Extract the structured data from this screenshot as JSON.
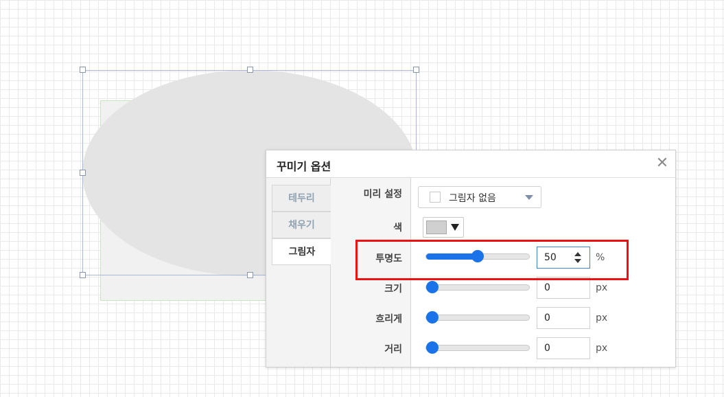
{
  "dialog": {
    "title": "꾸미기 옵션",
    "close_glyph": "✕"
  },
  "tabs": [
    {
      "label": "테두리",
      "active": false
    },
    {
      "label": "채우기",
      "active": false
    },
    {
      "label": "그림자",
      "active": true
    }
  ],
  "fields": {
    "preset": {
      "label": "미리 설정",
      "value": "그림자 없음"
    },
    "color": {
      "label": "색",
      "value": "#d0d0d0"
    },
    "opacity": {
      "label": "투명도",
      "value": "50",
      "unit": "%",
      "level": 0.5
    },
    "size": {
      "label": "크기",
      "value": "0",
      "unit": "px",
      "level": 0
    },
    "blur": {
      "label": "흐리게",
      "value": "0",
      "unit": "px",
      "level": 0
    },
    "distance": {
      "label": "거리",
      "value": "0",
      "unit": "px",
      "level": 0
    }
  },
  "colors": {
    "accent": "#1a73e8",
    "highlight_border": "#ee1111",
    "shape_fill": "#e4e4e4"
  }
}
